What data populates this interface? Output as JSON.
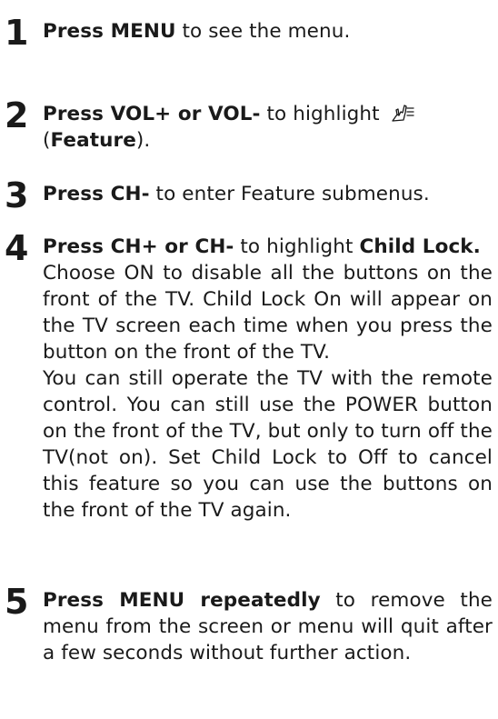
{
  "steps": [
    {
      "number": "1",
      "bold": "Press MENU",
      "rest": " to see the menu."
    },
    {
      "number": "2",
      "bold": "Press VOL+ or VOL-",
      "rest": " to highlight ",
      "icon": "feature-icon",
      "open_paren": "(",
      "feature_word": "Feature",
      "close_paren": ")."
    },
    {
      "number": "3",
      "bold": "Press CH-",
      "rest": " to enter Feature submenus."
    },
    {
      "number": "4",
      "bold": "Press CH+ or CH-",
      "rest": " to highlight ",
      "bold2": "Child Lock.",
      "para1": "Choose ON to disable all the buttons on the front of the TV. Child Lock On will appear on the TV screen each time when you press the button on the front of the TV.",
      "para2": "You can still operate the TV with the remote control. You can still use the POWER button on the front of the TV, but only to turn off the TV(not on). Set Child Lock to Off to cancel this feature so you can use the buttons on the front of the TV again."
    },
    {
      "number": "5",
      "bold": "Press MENU repeatedly",
      "rest": " to remove the menu from the screen or menu will quit after a few seconds without further action."
    }
  ]
}
